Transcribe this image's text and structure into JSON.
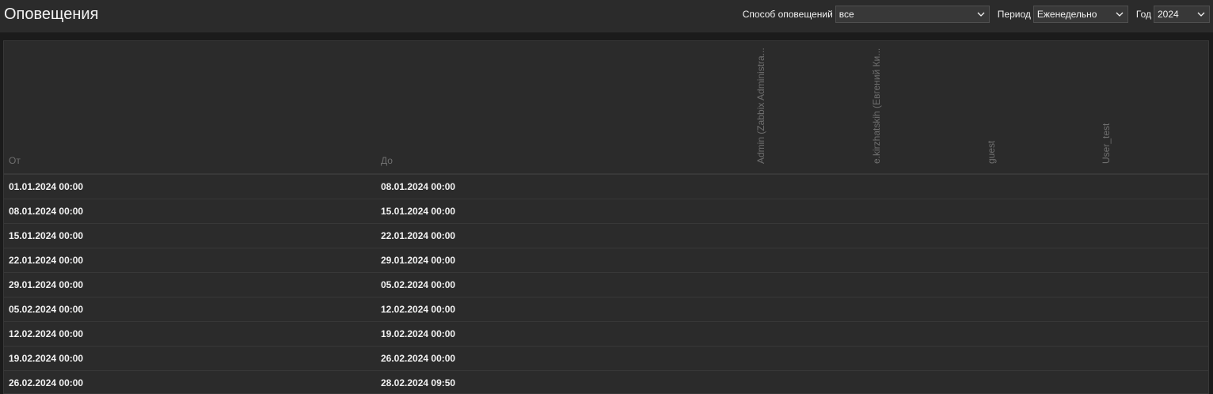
{
  "header": {
    "title": "Оповещения",
    "filters": {
      "method_label": "Способ оповещений",
      "method_value": "все",
      "period_label": "Период",
      "period_value": "Еженедельно",
      "year_label": "Год",
      "year_value": "2024"
    }
  },
  "table": {
    "columns": {
      "from": "От",
      "to": "До"
    },
    "users": [
      "Admin (Zabbix Administra...",
      "e.kirzhatskih (Евгений Ки...",
      "guest",
      "User_test"
    ],
    "rows": [
      {
        "from": "01.01.2024 00:00",
        "to": "08.01.2024 00:00"
      },
      {
        "from": "08.01.2024 00:00",
        "to": "15.01.2024 00:00"
      },
      {
        "from": "15.01.2024 00:00",
        "to": "22.01.2024 00:00"
      },
      {
        "from": "22.01.2024 00:00",
        "to": "29.01.2024 00:00"
      },
      {
        "from": "29.01.2024 00:00",
        "to": "05.02.2024 00:00"
      },
      {
        "from": "05.02.2024 00:00",
        "to": "12.02.2024 00:00"
      },
      {
        "from": "12.02.2024 00:00",
        "to": "19.02.2024 00:00"
      },
      {
        "from": "19.02.2024 00:00",
        "to": "26.02.2024 00:00"
      },
      {
        "from": "26.02.2024 00:00",
        "to": "28.02.2024 09:50"
      }
    ]
  },
  "colors": {
    "background": "#1b1b1b",
    "panel": "#2b2b2b",
    "border": "#383838",
    "text": "#f2f2f2",
    "muted_text": "#6f6f6f"
  }
}
